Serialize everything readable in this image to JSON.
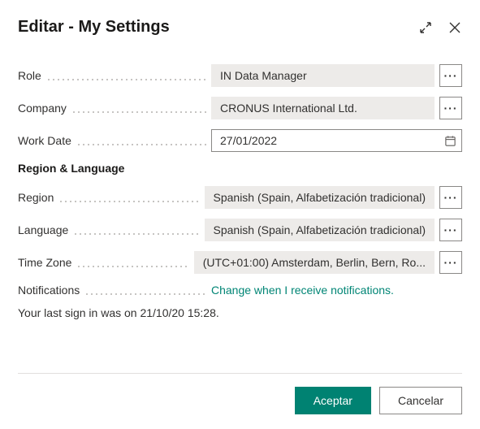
{
  "header": {
    "title": "Editar - My Settings"
  },
  "fields": {
    "role": {
      "label": "Role",
      "value": "IN Data Manager"
    },
    "company": {
      "label": "Company",
      "value": "CRONUS International Ltd."
    },
    "workDate": {
      "label": "Work Date",
      "value": "27/01/2022"
    }
  },
  "section": {
    "title": "Region & Language",
    "region": {
      "label": "Region",
      "value": "Spanish (Spain, Alfabetización tradicional)"
    },
    "language": {
      "label": "Language",
      "value": "Spanish (Spain, Alfabetización tradicional)"
    },
    "timeZone": {
      "label": "Time Zone",
      "value": "(UTC+01:00) Amsterdam, Berlin, Bern, Ro..."
    },
    "notifications": {
      "label": "Notifications",
      "linkText": "Change when I receive notifications."
    }
  },
  "signinInfo": "Your last sign in was on 21/10/20 15:28.",
  "buttons": {
    "accept": "Aceptar",
    "cancel": "Cancelar",
    "assist": "···"
  }
}
